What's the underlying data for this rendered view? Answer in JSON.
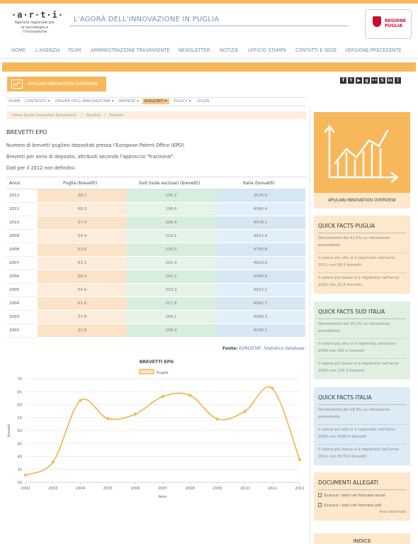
{
  "header": {
    "logo_mark": "·a·r·t·i·",
    "logo_text": "Agenzia regionale per la tecnologia e l'innovazione",
    "site_title": "L'AGORÀ DELL'INNOVAZIONE IN PUGLIA",
    "regione_label_1": "REGIONE",
    "regione_label_2": "PUGLIA"
  },
  "main_nav": [
    "HOME",
    "L'AGENZIA",
    "TEAM",
    "AMMINISTRAZIONE TRASPARENTE",
    "NEWSLETTER",
    "NOTIZIE",
    "UFFICIO STAMPA",
    "CONTATTI E SEDE",
    "VERSIONE PRECEDENTE"
  ],
  "overview_button": "APULIAN INNOVATION OVERVIEW",
  "social_icons": [
    "facebook-icon",
    "twitter-icon",
    "youtube-icon",
    "google-plus-icon",
    "flickr-icon",
    "slideshare-icon",
    "linkedin-icon",
    "rss-icon"
  ],
  "social_glyphs": [
    "f",
    "t",
    "▶",
    "g",
    "••",
    "S",
    "in",
    ")"
  ],
  "sub_nav": [
    "HOME",
    "CONTESTO ▾",
    "DRIVER DELL'INNOVAZIONE ▾",
    "IMPRESE ▾",
    "RISULTATI ▾",
    "POLICY ▾",
    "LOGIN"
  ],
  "breadcrumb": [
    "Home Apulia Innovation Scoreboard",
    "/",
    "Risultati",
    "/",
    "Brevetti"
  ],
  "page": {
    "title": "BREVETTI EPO",
    "desc_1": "Numero di brevetti pugliesi depositati presso l'European Patent Office (EPO).",
    "desc_2": "Brevetti per anno di deposito, attribuiti secondo l'approccio \"fractional\".",
    "desc_3": "Dati per il 2012 non definitivi."
  },
  "table": {
    "headers": [
      "Anno",
      "Puglia (brevetti)",
      "Sud (isole escluse) (brevetti)",
      "Italia (brevetti)"
    ],
    "rows": [
      [
        "2012",
        "38.7",
        "145.2",
        "3576.0"
      ],
      [
        "2011",
        "66.3",
        "196.8",
        "4384.4"
      ],
      [
        "2010",
        "57.4",
        "196.8",
        "4478.1"
      ],
      [
        "2009",
        "54.4",
        "210.1",
        "4413.4"
      ],
      [
        "2008",
        "63.6",
        "236.0",
        "4745.8"
      ],
      [
        "2007",
        "63.1",
        "232.4",
        "4919.0"
      ],
      [
        "2006",
        "56.3",
        "242.2",
        "5066.0"
      ],
      [
        "2005",
        "54.6",
        "233.3",
        "4913.2"
      ],
      [
        "2004",
        "61.6",
        "217.8",
        "4592.7"
      ],
      [
        "2003",
        "37.8",
        "166.1",
        "4396.3"
      ],
      [
        "2002",
        "32.8",
        "139.3",
        "4230.1"
      ]
    ]
  },
  "source": {
    "label": "Fonte:",
    "text": "EUROSTAT, Statistics database"
  },
  "chart_data": {
    "type": "line",
    "title": "BREVETTI EPO",
    "xlabel": "Anni",
    "ylabel": "Brevetti",
    "x": [
      "2002",
      "2003",
      "2004",
      "2005",
      "2006",
      "2007",
      "2008",
      "2009",
      "2010",
      "2011",
      "2012"
    ],
    "series": [
      {
        "name": "Puglia",
        "values": [
          32.8,
          37.8,
          61.6,
          54.6,
          56.3,
          63.1,
          63.6,
          54.4,
          57.4,
          66.3,
          38.7
        ]
      }
    ],
    "ylim": [
      30,
      70
    ],
    "yticks": [
      "30",
      "35",
      "40",
      "45",
      "50",
      "55",
      "60",
      "65",
      "70"
    ],
    "grid": true,
    "legend": "top",
    "color": "#f7b85b"
  },
  "sidebar": {
    "overview_caption": "APULIAN INNOVATION OVERVIEW",
    "quick_puglia": {
      "title": "QUICK FACTS PUGLIA",
      "items": [
        "Decremento del 41.6% su rilevazione precedente",
        "Il valore più alto si è registrato nell'anno 2011 con 66.3 brevetti",
        "Il valore più basso si è registrato nell'anno 2002 con 32.8 brevetti"
      ]
    },
    "quick_sud": {
      "title": "QUICK FACTS SUD ITALIA",
      "items": [
        "Decremento del 26.2% su rilevazione precedente",
        "Il valore più alto si è registrato nell'anno 2006 con 242.2 brevetti",
        "Il valore più basso si è registrato nell'anno 2002 con 139.3 brevetti"
      ]
    },
    "quick_italia": {
      "title": "QUICK FACTS ITALIA",
      "items": [
        "Decremento del 18.4% su rilevazione precedente",
        "Il valore più alto si è registrato nell'anno 2006 con 5066.0 brevetti",
        "Il valore più basso si è registrato nell'anno 2012 con 3576.0 brevetti"
      ]
    },
    "documents": {
      "title": "DOCUMENTI ALLEGATI",
      "links": [
        "Scarica i dati nel formato excel",
        "Scarica i dati nel formato pdf"
      ],
      "area": "Area download"
    },
    "index_title": "INDICE"
  },
  "colors": {
    "accent": "#f7b85b",
    "puglia": "#fbe3c8",
    "sud": "#d8eedd",
    "italia": "#d6e7f4"
  }
}
